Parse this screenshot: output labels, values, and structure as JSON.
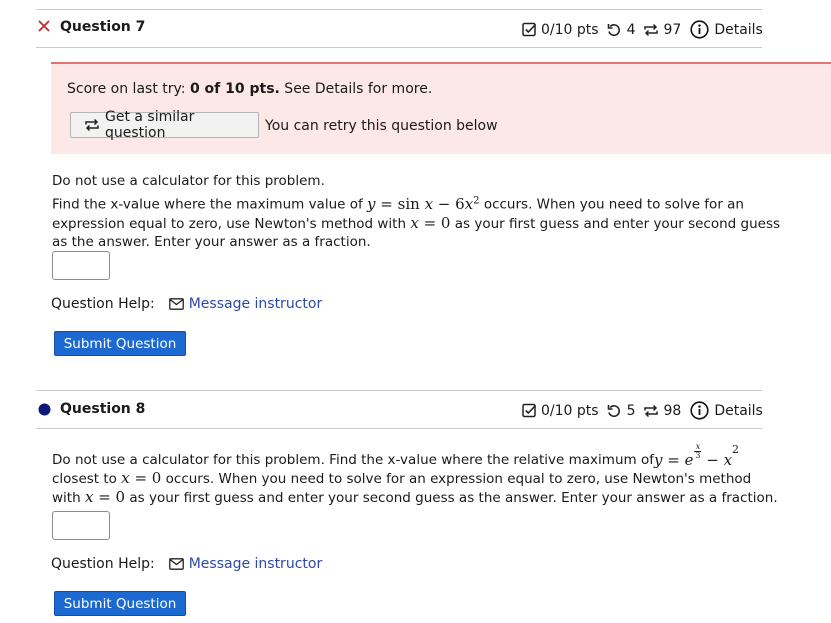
{
  "q7": {
    "title": "Question 7",
    "score": "0/10 pts",
    "retries": "4",
    "attempts": "97",
    "details": "Details",
    "feedback": {
      "prefix": "Score on last try: ",
      "score_bold": "0 of 10 pts.",
      "suffix": " See Details for more."
    },
    "similar_button": "Get a similar question",
    "retry_text": "You can retry this question below",
    "line1": "Do not use a calculator for this problem.",
    "line2_a": "Find the x-value where the maximum value of ",
    "line2_b": " occurs. When you need to solve for an",
    "line3_a": "expression equal to zero, use Newton's method with ",
    "line3_b": " as your first guess and enter your second guess",
    "line4": "as the answer. Enter your answer as a fraction.",
    "help_label": "Question Help:",
    "message_link": "Message instructor",
    "submit": "Submit Question"
  },
  "q8": {
    "title": "Question 8",
    "score": "0/10 pts",
    "retries": "5",
    "attempts": "98",
    "details": "Details",
    "line1_a": "Do not use a calculator for this problem. Find the x-value where the relative maximum of ",
    "line2_a": "closest to ",
    "line2_b": " occurs. When you need to solve for an expression equal to zero, use Newton's method",
    "line3_a": "with ",
    "line3_b": " as your first guess and enter your second guess as the answer. Enter your answer as a fraction.",
    "help_label": "Question Help:",
    "message_link": "Message instructor",
    "submit": "Submit Question"
  },
  "colors": {
    "incorrect_x": "#c62828",
    "feedback_bg": "#fde8e8",
    "feedback_border": "#e57373",
    "status_dot": "#0d1a7a",
    "submit_bg": "#1c6ad1",
    "link": "#2b4aa7"
  },
  "icons": {
    "q7_status": "x-mark-icon",
    "q8_status": "filled-circle-icon",
    "score": "checkbox-icon",
    "retries": "undo-icon",
    "attempts": "repeat-icon",
    "details": "info-icon",
    "message": "envelope-icon"
  }
}
